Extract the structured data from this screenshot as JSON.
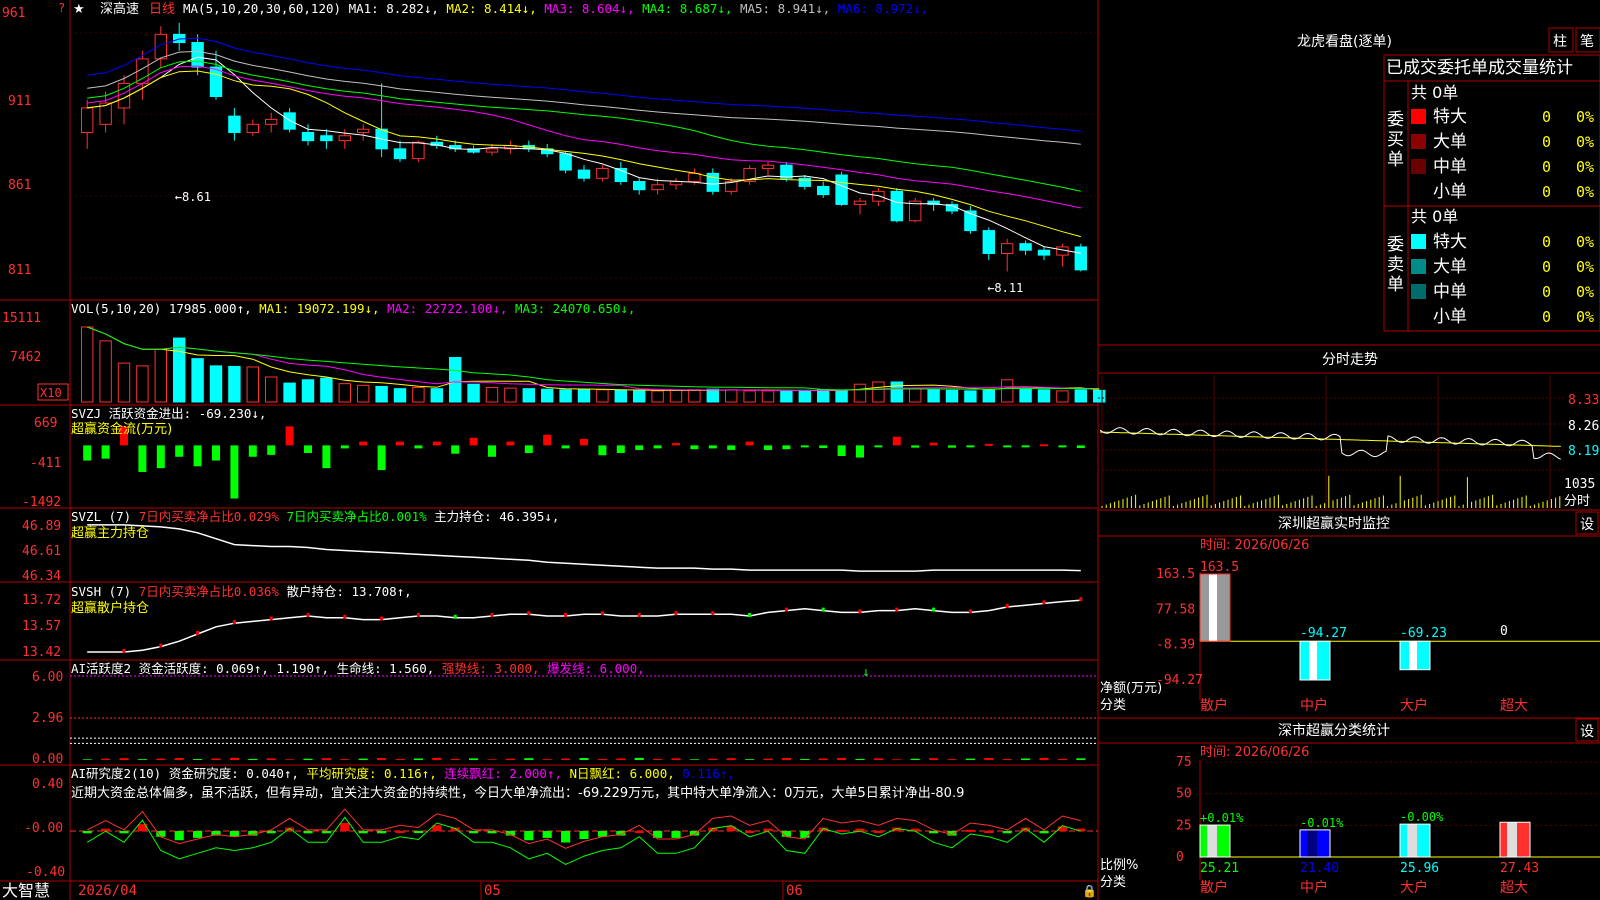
{
  "app": {
    "brand": "大智慧",
    "stock_name": "深高速",
    "period": "日线",
    "star": "★"
  },
  "colors": {
    "bg": "#000000",
    "grid": "#8b0000",
    "border": "#b00000",
    "up": "#ff3030",
    "down": "#00ffff",
    "ma1": "#ffffff",
    "ma2": "#ffff00",
    "ma3": "#ff00ff",
    "ma4": "#00ff00",
    "ma5": "#c0c0c0",
    "ma6": "#0000ff",
    "axis_text": "#ff3030",
    "title_text": "#ffffff"
  },
  "price_panel": {
    "title": "MA(5,10,20,30,60,120)",
    "ma": [
      {
        "label": "MA1:",
        "value": "8.282",
        "arrow": "↓",
        "color": "#ffffff"
      },
      {
        "label": "MA2:",
        "value": "8.414",
        "arrow": "↓",
        "color": "#ffff00"
      },
      {
        "label": "MA3:",
        "value": "8.604",
        "arrow": "↓",
        "color": "#ff00ff"
      },
      {
        "label": "MA4:",
        "value": "8.687",
        "arrow": "↓",
        "color": "#00ff00"
      },
      {
        "label": "MA5:",
        "value": "8.941",
        "arrow": "↓",
        "color": "#c0c0c0"
      },
      {
        "label": "MA6:",
        "value": "8.972",
        "arrow": "↓",
        "color": "#0000ff"
      }
    ],
    "y_ticks": [
      "961",
      "911",
      "861",
      "811"
    ],
    "high_label": "8.61",
    "low_label": "8.11"
  },
  "vol_panel": {
    "title": "VOL(5,10,20)",
    "value": "17985.000",
    "value_arrow": "↑",
    "ma": [
      {
        "label": "MA1:",
        "value": "19072.199",
        "arrow": "↓",
        "color": "#ffff00"
      },
      {
        "label": "MA2:",
        "value": "22722.100",
        "arrow": "↓",
        "color": "#ff00ff"
      },
      {
        "label": "MA3:",
        "value": "24070.650",
        "arrow": "↓",
        "color": "#00ff00"
      }
    ],
    "y_ticks": [
      "15111",
      "7462"
    ],
    "unit": "X10"
  },
  "svzj_panel": {
    "title": "SVZJ",
    "label": "活跃资金进出:",
    "value": "-69.230",
    "arrow": "↓",
    "subtitle": "超赢资金流(万元)",
    "y_ticks": [
      "669",
      "-411",
      "-1492"
    ]
  },
  "svzl_panel": {
    "title": "SVZL (7)",
    "text1": "7日内买卖净占比0.029%",
    "text2": "7日内买卖净占比0.001%",
    "label": "主力持仓:",
    "value": "46.395",
    "arrow": "↓",
    "subtitle": "超赢主力持仓",
    "y_ticks": [
      "46.89",
      "46.61",
      "46.34"
    ]
  },
  "svsh_panel": {
    "title": "SVSH (7)",
    "text1": "7日内买卖净占比0.036%",
    "label": "散户持仓:",
    "value": "13.708",
    "arrow": "↑",
    "subtitle": "超赢散户持仓",
    "y_ticks": [
      "13.72",
      "13.57",
      "13.42"
    ]
  },
  "ai_active_panel": {
    "title": "AI活跃度2",
    "label": "资金活跃度:",
    "v1": "0.069",
    "v2": "1.190",
    "l3": "生命线:",
    "v3": "1.560",
    "l4": "强势线:",
    "v4": "3.000",
    "l5": "爆发线:",
    "v5": "6.000",
    "y_ticks": [
      "6.00",
      "2.96",
      "0.00"
    ]
  },
  "ai_research_panel": {
    "title": "AI研究度2(10)",
    "label": "资金研究度:",
    "v1": "0.040",
    "l2": "平均研究度:",
    "v2": "0.116",
    "l3": "连续飘红:",
    "v3": "2.000",
    "l4": "N日飘红:",
    "v4": "6.000",
    "v5": "0.116",
    "comment": "近期大资金总体偏多，虽不活跃，但有异动，宜关注大资金的持续性，今日大单净流出：-69.229万元，其中特大单净流入：0万元，大单5日累计净出-80.9",
    "y_ticks": [
      "0.40",
      "-0.00",
      "-0.40"
    ]
  },
  "x_axis": {
    "labels": [
      "2026/04",
      "05",
      "06"
    ]
  },
  "dragon_tiger": {
    "title": "龙虎看盘(逐单)",
    "btn_zhu": "柱",
    "btn_bi": "笔",
    "header": "已成交委托单成交量统计",
    "buy_side": "委买单",
    "sell_side": "委卖单",
    "buy_total": "共 0单",
    "sell_total": "共 0单",
    "rows_buy": [
      {
        "label": "特大",
        "count": "0",
        "pct": "0%",
        "color": "#ff0000"
      },
      {
        "label": "大单",
        "count": "0",
        "pct": "0%",
        "color": "#8b0000"
      },
      {
        "label": "中单",
        "count": "0",
        "pct": "0%",
        "color": "#6b0000"
      },
      {
        "label": "小单",
        "count": "0",
        "pct": "0%",
        "color": ""
      }
    ],
    "rows_sell": [
      {
        "label": "特大",
        "count": "0",
        "pct": "0%",
        "color": "#00ffff"
      },
      {
        "label": "大单",
        "count": "0",
        "pct": "0%",
        "color": "#008b8b"
      },
      {
        "label": "中单",
        "count": "0",
        "pct": "0%",
        "color": "#006b6b"
      },
      {
        "label": "小单",
        "count": "0",
        "pct": "0%",
        "color": ""
      }
    ]
  },
  "intraday": {
    "title": "分时走势",
    "y_ticks": [
      "8.33",
      "8.26",
      "8.19"
    ],
    "vol_label": "1035",
    "vol_unit": "分时"
  },
  "sz_monitor": {
    "title": "深圳超赢实时监控",
    "btn": "设",
    "time": "时间: 2026/06/26",
    "y_ticks": [
      "163.5",
      "77.58",
      "-8.39",
      "-94.27"
    ],
    "ylabel": "净额(万元)",
    "xlabel": "分类",
    "categories": [
      "散户",
      "中户",
      "大户",
      "超大"
    ],
    "values": [
      163.5,
      -94.27,
      -69.23,
      0
    ],
    "value_labels": [
      "163.5",
      "-94.27",
      "-69.23",
      "0"
    ]
  },
  "sz_stats": {
    "title": "深市超赢分类统计",
    "btn": "设",
    "time": "时间: 2026/06/26",
    "y_ticks": [
      "75",
      "50",
      "25",
      "0"
    ],
    "ylabel": "比例%",
    "xlabel": "分类",
    "categories": [
      "散户",
      "中户",
      "大户",
      "超大"
    ],
    "values": [
      25.21,
      21.4,
      25.96,
      27.43
    ],
    "value_labels": [
      "25.21",
      "21.40",
      "25.96",
      "27.43"
    ],
    "change_labels": [
      "+0.01%",
      "-0.01%",
      "-0.00%",
      ""
    ],
    "bar_colors": [
      "#00ff00",
      "#0000ff",
      "#00ffff",
      "#ff3030"
    ]
  },
  "chart_data": [
    {
      "type": "candlestick",
      "title": "深高速 日线",
      "x_labels": [
        "2026/04",
        "05",
        "06"
      ],
      "ylim": [
        8.0,
        9.7
      ],
      "ohlc": [
        [
          9.0,
          9.2,
          8.9,
          9.15
        ],
        [
          9.05,
          9.25,
          9.0,
          9.18
        ],
        [
          9.15,
          9.35,
          9.05,
          9.3
        ],
        [
          9.3,
          9.5,
          9.2,
          9.45
        ],
        [
          9.45,
          9.65,
          9.4,
          9.6
        ],
        [
          9.6,
          9.67,
          9.5,
          9.55
        ],
        [
          9.55,
          9.6,
          9.35,
          9.4
        ],
        [
          9.4,
          9.5,
          9.2,
          9.22
        ],
        [
          9.1,
          9.15,
          8.95,
          9.0
        ],
        [
          9.0,
          9.08,
          8.98,
          9.05
        ],
        [
          9.05,
          9.12,
          9.0,
          9.08
        ],
        [
          9.12,
          9.15,
          9.0,
          9.02
        ],
        [
          9.0,
          9.05,
          8.92,
          8.95
        ],
        [
          8.98,
          9.02,
          8.9,
          8.95
        ],
        [
          8.95,
          9.02,
          8.9,
          8.98
        ],
        [
          9.0,
          9.05,
          8.95,
          9.02
        ],
        [
          9.02,
          9.3,
          8.85,
          8.9
        ],
        [
          8.9,
          8.95,
          8.82,
          8.84
        ],
        [
          8.84,
          8.95,
          8.82,
          8.94
        ],
        [
          8.94,
          8.98,
          8.9,
          8.92
        ],
        [
          8.92,
          8.95,
          8.88,
          8.9
        ],
        [
          8.9,
          8.92,
          8.87,
          8.88
        ],
        [
          8.88,
          8.93,
          8.86,
          8.9
        ],
        [
          8.9,
          8.95,
          8.87,
          8.92
        ],
        [
          8.92,
          8.95,
          8.88,
          8.9
        ],
        [
          8.9,
          8.93,
          8.85,
          8.87
        ],
        [
          8.87,
          8.88,
          8.75,
          8.77
        ],
        [
          8.77,
          8.8,
          8.7,
          8.72
        ],
        [
          8.72,
          8.8,
          8.7,
          8.78
        ],
        [
          8.78,
          8.82,
          8.68,
          8.7
        ],
        [
          8.7,
          8.72,
          8.62,
          8.65
        ],
        [
          8.65,
          8.72,
          8.62,
          8.68
        ],
        [
          8.68,
          8.72,
          8.65,
          8.7
        ],
        [
          8.7,
          8.78,
          8.68,
          8.75
        ],
        [
          8.75,
          8.78,
          8.62,
          8.64
        ],
        [
          8.64,
          8.72,
          8.62,
          8.7
        ],
        [
          8.7,
          8.8,
          8.68,
          8.78
        ],
        [
          8.78,
          8.82,
          8.74,
          8.8
        ],
        [
          8.8,
          8.82,
          8.7,
          8.72
        ],
        [
          8.72,
          8.74,
          8.65,
          8.67
        ],
        [
          8.67,
          8.7,
          8.6,
          8.62
        ],
        [
          8.74,
          8.76,
          8.55,
          8.56
        ],
        [
          8.56,
          8.6,
          8.5,
          8.58
        ],
        [
          8.58,
          8.66,
          8.55,
          8.64
        ],
        [
          8.64,
          8.66,
          8.45,
          8.46
        ],
        [
          8.46,
          8.6,
          8.45,
          8.58
        ],
        [
          8.58,
          8.6,
          8.52,
          8.56
        ],
        [
          8.56,
          8.58,
          8.5,
          8.52
        ],
        [
          8.52,
          8.55,
          8.38,
          8.4
        ],
        [
          8.4,
          8.42,
          8.22,
          8.26
        ],
        [
          8.26,
          8.35,
          8.15,
          8.32
        ],
        [
          8.32,
          8.34,
          8.25,
          8.28
        ],
        [
          8.28,
          8.3,
          8.22,
          8.25
        ],
        [
          8.25,
          8.32,
          8.18,
          8.3
        ],
        [
          8.3,
          8.32,
          8.15,
          8.16
        ]
      ],
      "ma_last": {
        "MA1": 8.282,
        "MA2": 8.414,
        "MA3": 8.604,
        "MA4": 8.687,
        "MA5": 8.941,
        "MA6": 8.972
      },
      "high_marker": 8.61,
      "low_marker": 8.11
    },
    {
      "type": "bar",
      "title": "VOL(5,10,20)",
      "ylim": [
        0,
        15111
      ],
      "values": [
        13500,
        11000,
        7000,
        6500,
        9500,
        11500,
        7800,
        6500,
        6400,
        6300,
        4500,
        3400,
        4000,
        4300,
        3300,
        3000,
        2800,
        2400,
        2600,
        2400,
        8000,
        3200,
        2600,
        2500,
        2400,
        2300,
        2200,
        2300,
        2200,
        2100,
        2000,
        2000,
        2100,
        2200,
        2300,
        2200,
        2000,
        2000,
        2000,
        2100,
        2200,
        2000,
        3200,
        3600,
        3600,
        2500,
        2300,
        2100,
        2000,
        2100,
        4000,
        2300,
        2200,
        2000,
        2200,
        2100
      ]
    },
    {
      "type": "bar",
      "title": "超赢资金流(万元)",
      "ylim": [
        -1492,
        669
      ],
      "values": [
        -400,
        -350,
        500,
        -700,
        -600,
        -300,
        -550,
        -400,
        -1400,
        -300,
        -250,
        500,
        -200,
        -600,
        -80,
        100,
        -650,
        100,
        -80,
        100,
        -220,
        200,
        -300,
        100,
        -200,
        280,
        -80,
        170,
        -260,
        -200,
        -120,
        -80,
        60,
        -100,
        -80,
        -120,
        100,
        -120,
        -100,
        -50,
        -70,
        -280,
        -320,
        -30,
        230,
        -60,
        70,
        -60,
        -50,
        40,
        -30,
        -20,
        30,
        -20,
        -69.23
      ]
    },
    {
      "type": "line",
      "title": "超赢主力持仓",
      "ylim": [
        46.34,
        46.89
      ],
      "values": [
        46.86,
        46.86,
        46.86,
        46.85,
        46.84,
        46.82,
        46.78,
        46.72,
        46.66,
        46.65,
        46.64,
        46.64,
        46.63,
        46.61,
        46.6,
        46.59,
        46.58,
        46.57,
        46.56,
        46.55,
        46.54,
        46.53,
        46.52,
        46.51,
        46.5,
        46.48,
        46.47,
        46.46,
        46.45,
        46.44,
        46.43,
        46.42,
        46.42,
        46.42,
        46.41,
        46.41,
        46.4,
        46.4,
        46.4,
        46.4,
        46.4,
        46.4,
        46.39,
        46.39,
        46.39,
        46.39,
        46.4,
        46.4,
        46.4,
        46.4,
        46.4,
        46.4,
        46.4,
        46.4,
        46.395
      ]
    },
    {
      "type": "line",
      "title": "超赢散户持仓",
      "ylim": [
        13.42,
        13.72
      ],
      "values": [
        13.42,
        13.42,
        13.42,
        13.43,
        13.45,
        13.48,
        13.52,
        13.56,
        13.58,
        13.59,
        13.6,
        13.61,
        13.62,
        13.61,
        13.61,
        13.6,
        13.6,
        13.61,
        13.62,
        13.62,
        13.61,
        13.61,
        13.62,
        13.63,
        13.63,
        13.62,
        13.62,
        13.63,
        13.63,
        13.62,
        13.62,
        13.62,
        13.63,
        13.63,
        13.63,
        13.63,
        13.62,
        13.64,
        13.65,
        13.66,
        13.65,
        13.64,
        13.64,
        13.65,
        13.65,
        13.66,
        13.65,
        13.64,
        13.64,
        13.65,
        13.67,
        13.68,
        13.69,
        13.7,
        13.708
      ]
    },
    {
      "type": "line",
      "title": "AI活跃度2",
      "ylim": [
        0,
        6.0
      ],
      "lines": {
        "强势线": 3.0,
        "爆发线": 6.0,
        "生命线": 1.56,
        "资金活跃度": 0.069,
        "v2": 1.19
      }
    },
    {
      "type": "bar",
      "title": "AI研究度2(10)",
      "ylim": [
        -0.4,
        0.4
      ],
      "values": [
        -0.02,
        0.02,
        -0.02,
        0.06,
        -0.05,
        -0.08,
        -0.06,
        -0.04,
        -0.05,
        -0.04,
        -0.02,
        0.03,
        -0.02,
        -0.02,
        0.07,
        -0.02,
        -0.02,
        0.0,
        -0.01,
        0.05,
        0.03,
        -0.02,
        -0.02,
        -0.04,
        -0.08,
        -0.06,
        -0.1,
        -0.07,
        -0.05,
        -0.04,
        0.0,
        -0.06,
        -0.06,
        -0.04,
        0.03,
        0.04,
        0.0,
        0.02,
        -0.05,
        -0.06,
        0.03,
        0.01,
        0.02,
        0.0,
        0.03,
        0.02,
        -0.02,
        -0.04,
        0.01,
        0.0,
        -0.02,
        0.03,
        -0.02,
        0.04,
        0.02
      ]
    },
    {
      "type": "bar",
      "title": "深圳超赢实时监控",
      "categories": [
        "散户",
        "中户",
        "大户",
        "超大"
      ],
      "values": [
        163.5,
        -94.27,
        -69.23,
        0
      ],
      "ylabel": "净额(万元)",
      "ylim": [
        -94.27,
        163.5
      ]
    },
    {
      "type": "bar",
      "title": "深市超赢分类统计",
      "categories": [
        "散户",
        "中户",
        "大户",
        "超大"
      ],
      "values": [
        25.21,
        21.4,
        25.96,
        27.43
      ],
      "ylabel": "比例%",
      "ylim": [
        0,
        75
      ]
    }
  ]
}
